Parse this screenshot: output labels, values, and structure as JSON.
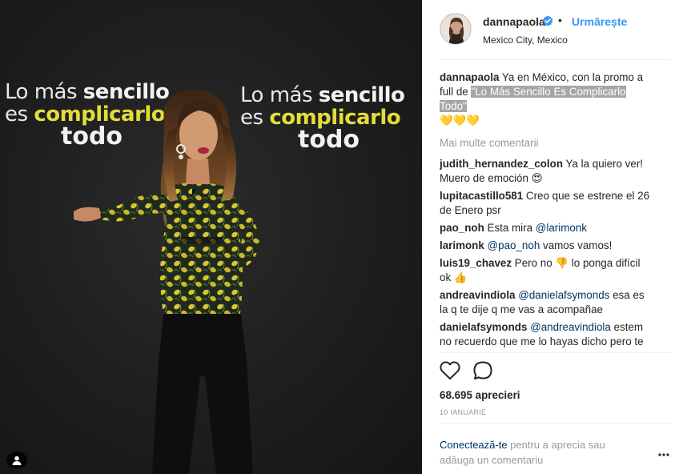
{
  "post": {
    "username": "dannapaola",
    "follow_label": "Urmărește",
    "separator": "•",
    "location": "Mexico City, Mexico"
  },
  "backdrop": {
    "line1_a": "Lo ",
    "line1_b": "más ",
    "line1_c": "sencillo",
    "line2_a": "es ",
    "line2_b": "complicarlo",
    "line3": "todo"
  },
  "caption": {
    "username": "dannapaola",
    "text_before": " Ya en México, con la promo a full de ",
    "highlight": "\"Lo Más Sencillo Es Complicarlo Todo\"",
    "hearts": "💛💛💛"
  },
  "more_comments_label": "Mai multe comentarii",
  "comments": [
    {
      "user": "judith_hernandez_colon",
      "text": " Ya la quiero ver! Muero de emoción 😍"
    },
    {
      "user": "lupitacastillo581",
      "text": " Creo que se estrene el 26 de Enero psr"
    },
    {
      "user": "pao_noh",
      "text": " Esta mira ",
      "mention": "@larimonk",
      "after": ""
    },
    {
      "user": "larimonk",
      "text": " ",
      "mention": "@pao_noh",
      "after": " vamos vamos!"
    },
    {
      "user": "luis19_chavez",
      "text": " Pero no 👎 lo ponga difícil ok 👍"
    },
    {
      "user": "andreavindiola",
      "text": " ",
      "mention": "@danielafsymonds",
      "after": " esa es la q te dije q me vas a acompañae"
    },
    {
      "user": "danielafsymonds",
      "text": " ",
      "mention": "@andreavindiola",
      "after": " estem no recuerdo que me lo hayas dicho pero te"
    }
  ],
  "likes": "68.695 aprecieri",
  "date": "10 IANUARIE",
  "login": {
    "link": "Conectează-te",
    "rest": " pentru a aprecia sau adăuga un comentariu"
  },
  "colors": {
    "link_blue": "#3897f0",
    "dark_link": "#003569",
    "muted": "#999999",
    "text": "#262626",
    "backdrop_yellow": "#e2dd3b"
  },
  "icons": [
    "user-tag-icon",
    "verified-badge-icon",
    "heart-icon",
    "comment-bubble-icon",
    "more-options-icon"
  ]
}
